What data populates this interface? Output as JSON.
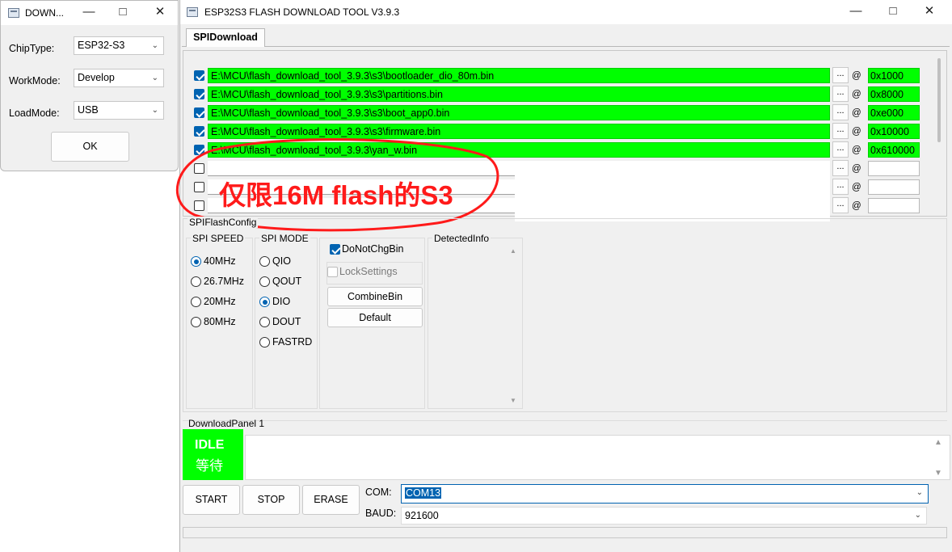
{
  "colors": {
    "success_green": "#00ff00",
    "accent_blue": "#0063b1",
    "annotation_red": "#ff1a1a"
  },
  "small_window": {
    "title": "DOWN...",
    "chip_type": {
      "label": "ChipType:",
      "value": "ESP32-S3"
    },
    "work_mode": {
      "label": "WorkMode:",
      "value": "Develop"
    },
    "load_mode": {
      "label": "LoadMode:",
      "value": "USB"
    },
    "ok_label": "OK"
  },
  "main_window": {
    "title": "ESP32S3 FLASH DOWNLOAD TOOL V3.9.3",
    "tab": "SPIDownload",
    "files": [
      {
        "checked": true,
        "path": "E:\\MCU\\flash_download_tool_3.9.3\\s3\\bootloader_dio_80m.bin",
        "address": "0x1000"
      },
      {
        "checked": true,
        "path": "E:\\MCU\\flash_download_tool_3.9.3\\s3\\partitions.bin",
        "address": "0x8000"
      },
      {
        "checked": true,
        "path": "E:\\MCU\\flash_download_tool_3.9.3\\s3\\boot_app0.bin",
        "address": "0xe000"
      },
      {
        "checked": true,
        "path": "E:\\MCU\\flash_download_tool_3.9.3\\s3\\firmware.bin",
        "address": "0x10000"
      },
      {
        "checked": true,
        "path": "E:\\MCU\\flash_download_tool_3.9.3\\yan_w.bin",
        "address": "0x610000"
      },
      {
        "checked": false,
        "path": "",
        "address": ""
      },
      {
        "checked": false,
        "path": "",
        "address": ""
      },
      {
        "checked": false,
        "path": "",
        "address": ""
      }
    ],
    "browse_label": "...",
    "at_label": "@",
    "annotation": "仅限16M flash的S3",
    "spi_flash_config": {
      "title": "SPIFlashConfig",
      "spi_speed": {
        "title": "SPI SPEED",
        "options": [
          "40MHz",
          "26.7MHz",
          "20MHz",
          "80MHz"
        ],
        "selected": "40MHz"
      },
      "spi_mode": {
        "title": "SPI MODE",
        "options": [
          "QIO",
          "QOUT",
          "DIO",
          "DOUT",
          "FASTRD"
        ],
        "selected": "DIO"
      },
      "do_not_chg_bin": "DoNotChgBin",
      "lock_settings": "LockSettings",
      "combine_bin": "CombineBin",
      "default": "Default",
      "detected_info": "DetectedInfo"
    },
    "download_panel": {
      "title": "DownloadPanel 1",
      "status_en": "IDLE",
      "status_zh": "等待",
      "start": "START",
      "stop": "STOP",
      "erase": "ERASE",
      "com_label": "COM:",
      "com_value": "COM13",
      "baud_label": "BAUD:",
      "baud_value": "921600"
    }
  }
}
